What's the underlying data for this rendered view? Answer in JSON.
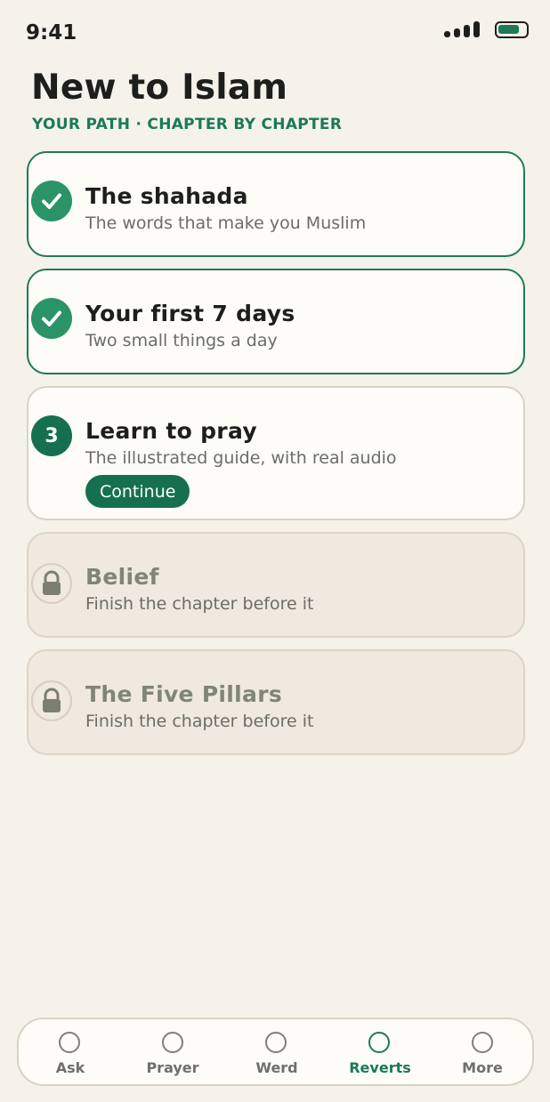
{
  "status_bar": {
    "time": "9:41",
    "battery_color": "#1f7a55"
  },
  "header": {
    "title": "New to Islam",
    "subtitle": "YOUR PATH · CHAPTER BY CHAPTER"
  },
  "chapters": [
    {
      "title": "The shahada",
      "description": "The words that make you Muslim",
      "state": "completed",
      "icon": "check-icon"
    },
    {
      "title": "Your first 7 days",
      "description": "Two small things a day",
      "state": "completed",
      "icon": "check-icon"
    },
    {
      "number": "3",
      "title": "Learn to pray",
      "description": "The illustrated guide, with real audio",
      "state": "current",
      "action_label": "Continue"
    },
    {
      "title": "Belief",
      "description": "Finish the chapter before it",
      "state": "locked",
      "icon": "lock-icon"
    },
    {
      "title": "The Five Pillars",
      "description": "Finish the chapter before it",
      "state": "locked",
      "icon": "lock-icon"
    }
  ],
  "tab_bar": {
    "active": "Reverts",
    "tabs": [
      {
        "label": "Ask"
      },
      {
        "label": "Prayer"
      },
      {
        "label": "Werd"
      },
      {
        "label": "Reverts"
      },
      {
        "label": "More"
      }
    ]
  },
  "colors": {
    "accent": "#1a7a57",
    "completed": "#2a9467",
    "background": "#f5f2ea",
    "locked_card": "#efe9df"
  }
}
